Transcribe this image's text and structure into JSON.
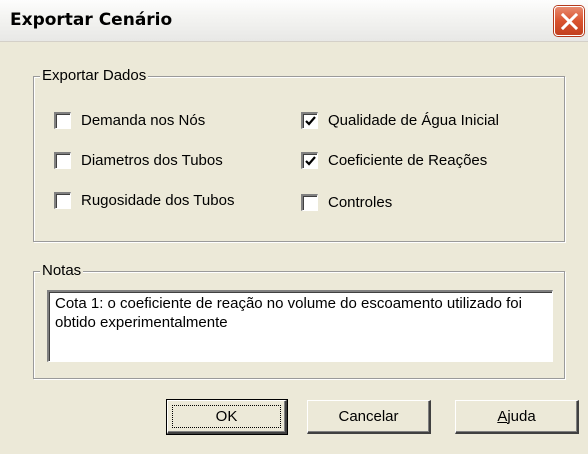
{
  "window": {
    "title": "Exportar Cenário"
  },
  "export_group": {
    "legend": "Exportar Dados",
    "options": [
      {
        "label": "Demanda nos Nós",
        "checked": false
      },
      {
        "label": "Diametros dos Tubos",
        "checked": false
      },
      {
        "label": "Rugosidade dos Tubos",
        "checked": false
      },
      {
        "label": "Qualidade de Água Inicial",
        "checked": true
      },
      {
        "label": "Coeficiente de Reações",
        "checked": true
      },
      {
        "label": "Controles",
        "checked": false
      }
    ]
  },
  "notes_group": {
    "legend": "Notas",
    "text": "Cota 1: o coeficiente de reação no volume do escoamento utilizado foi obtido experimentalmente"
  },
  "buttons": {
    "ok": "OK",
    "cancel": "Cancelar",
    "help_mnemonic": "A",
    "help_rest": "juda"
  },
  "colors": {
    "dialog_background": "#ece9d8",
    "close_button": "#d9532f"
  }
}
